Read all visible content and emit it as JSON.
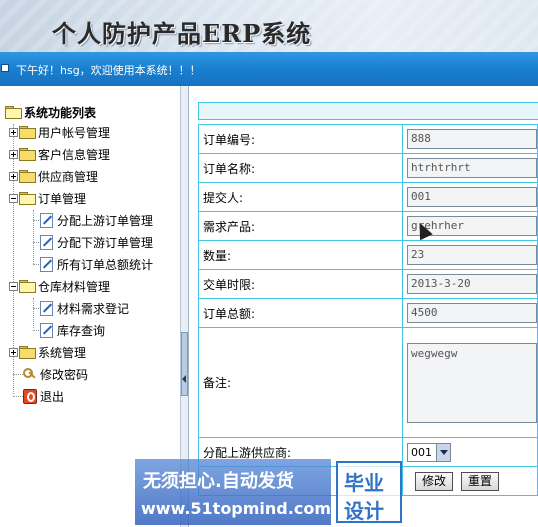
{
  "header": {
    "title": "个人防护产品ERP系统"
  },
  "welcome": {
    "text": "下午好！hsg，欢迎使用本系统！！！"
  },
  "sidebar": {
    "root": "系统功能列表",
    "items": {
      "user": "用户帐号管理",
      "customer": "客户信息管理",
      "supplier": "供应商管理",
      "order": "订单管理",
      "order_up": "分配上游订单管理",
      "order_down": "分配下游订单管理",
      "order_total": "所有订单总额统计",
      "warehouse": "仓库材料管理",
      "material_reg": "材料需求登记",
      "stock_query": "库存查询",
      "system": "系统管理",
      "password": "修改密码",
      "logout": "退出"
    }
  },
  "form": {
    "order_no": {
      "label": "订单编号:",
      "value": "888"
    },
    "order_name": {
      "label": "订单名称:",
      "value": "htrhtrhrt"
    },
    "submitter": {
      "label": "提交人:",
      "value": "001"
    },
    "product": {
      "label": "需求产品:",
      "value": "grehrher"
    },
    "quantity": {
      "label": "数量:",
      "value": "23"
    },
    "deadline": {
      "label": "交单时限:",
      "value": "2013-3-20"
    },
    "total": {
      "label": "订单总额:",
      "value": "4500"
    },
    "remarks": {
      "label": "备注:",
      "value": "wegwegw"
    },
    "supplier": {
      "label": "分配上游供应商:",
      "selected": "001"
    },
    "buttons": {
      "modify": "修改",
      "reset": "重置"
    }
  },
  "watermark": {
    "line1": "无须担心.自动发货",
    "line2": "www.51topmind.com",
    "badge1": "毕业",
    "badge2": "设计"
  }
}
